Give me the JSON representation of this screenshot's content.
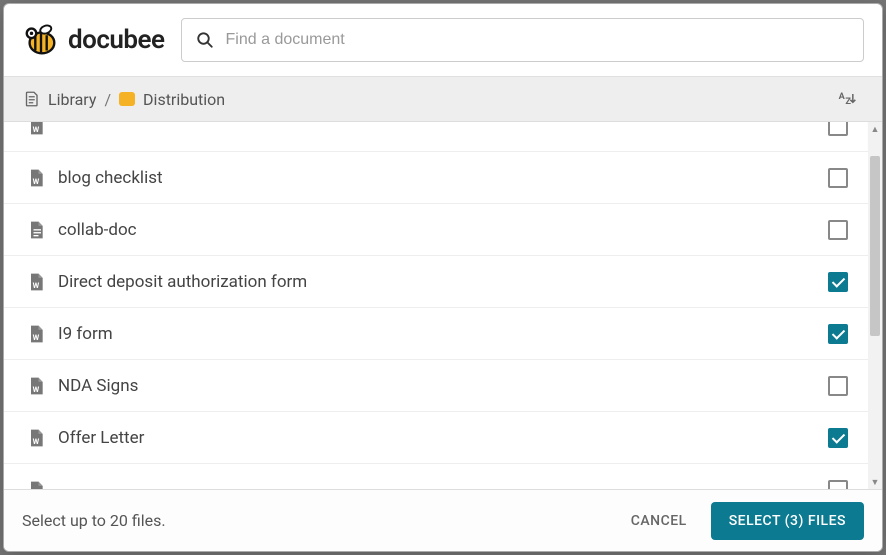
{
  "brand": {
    "name": "docubee"
  },
  "search": {
    "placeholder": "Find a document"
  },
  "breadcrumb": {
    "root": "Library",
    "sep": "/",
    "current": "Distribution"
  },
  "files": [
    {
      "name": "",
      "icon": "word",
      "checked": false
    },
    {
      "name": "blog checklist",
      "icon": "word",
      "checked": false
    },
    {
      "name": "collab-doc",
      "icon": "doc",
      "checked": false
    },
    {
      "name": "Direct deposit authorization form",
      "icon": "word",
      "checked": true
    },
    {
      "name": "I9 form",
      "icon": "word",
      "checked": true
    },
    {
      "name": "NDA Signs",
      "icon": "word",
      "checked": false
    },
    {
      "name": "Offer Letter",
      "icon": "word",
      "checked": true
    },
    {
      "name": "",
      "icon": "word",
      "checked": false
    }
  ],
  "footer": {
    "hint": "Select up to 20 files.",
    "cancel": "CANCEL",
    "select": "SELECT (3) FILES"
  }
}
